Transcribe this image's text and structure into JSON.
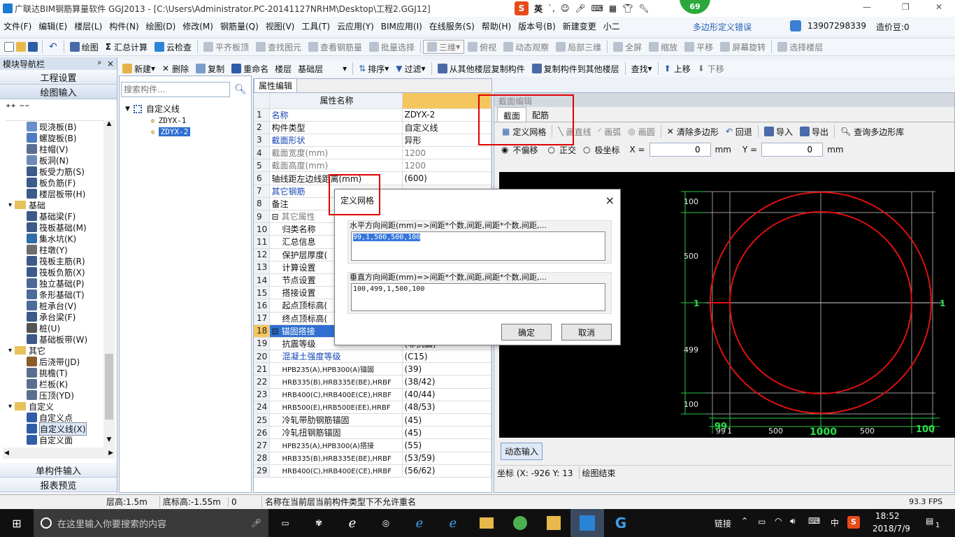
{
  "titlebar": {
    "app_title": "广联达BIM钢筋算量软件 GGJ2013 - [C:\\Users\\Administrator.PC-20141127NRHM\\Desktop\\工程2.GGJ12]",
    "ime_label": "英",
    "badge": "69",
    "window_controls": [
      "—",
      "❐",
      "✕"
    ]
  },
  "menubar": {
    "items": [
      "文件(F)",
      "编辑(E)",
      "楼层(L)",
      "构件(N)",
      "绘图(D)",
      "修改(M)",
      "钢筋量(Q)",
      "视图(V)",
      "工具(T)",
      "云应用(Y)",
      "BIM应用(I)",
      "在线服务(S)",
      "帮助(H)",
      "版本号(B)",
      "新建变更",
      "小二"
    ],
    "polygon_error": "多边形定义错误",
    "phone": "13907298339",
    "cost_bean": "造价豆:0"
  },
  "toolbar1": {
    "items": [
      "绘图",
      "汇总计算",
      "云检查",
      "平齐板顶",
      "查找图元",
      "查看钢筋量",
      "批量选择",
      "三维",
      "俯视",
      "动态观察",
      "局部三维",
      "全屏",
      "缩放",
      "平移",
      "屏幕旋转",
      "选择楼层"
    ]
  },
  "nav": {
    "title": "模块导航栏",
    "pin": "ᵖ",
    "close": "×",
    "buttons": [
      "工程设置",
      "绘图输入"
    ],
    "bottom_buttons": [
      "单构件输入",
      "报表预览"
    ],
    "tree": [
      {
        "label": "现浇板(B)",
        "level": 2,
        "icon_color": "#6b8fc9"
      },
      {
        "label": "螺旋板(B)",
        "level": 2,
        "icon_color": "#4e7cc2"
      },
      {
        "label": "柱帽(V)",
        "level": 2,
        "icon_color": "#5b6f93"
      },
      {
        "label": "板洞(N)",
        "level": 2,
        "icon_color": "#6e8bb5"
      },
      {
        "label": "板受力筋(S)",
        "level": 2,
        "icon_color": "#3c5a8a"
      },
      {
        "label": "板负筋(F)",
        "level": 2,
        "icon_color": "#3c5a8a"
      },
      {
        "label": "楼层板带(H)",
        "level": 2,
        "icon_color": "#3c5a8a"
      },
      {
        "label": "基础",
        "level": 1,
        "folder": true
      },
      {
        "label": "基础梁(F)",
        "level": 2,
        "icon_color": "#3c5a8a"
      },
      {
        "label": "筏板基础(M)",
        "level": 2,
        "icon_color": "#3c5a8a"
      },
      {
        "label": "集水坑(K)",
        "level": 2,
        "icon_color": "#2f6ea8"
      },
      {
        "label": "柱墩(Y)",
        "level": 2,
        "icon_color": "#6d6d6d"
      },
      {
        "label": "筏板主筋(R)",
        "level": 2,
        "icon_color": "#3c5a8a"
      },
      {
        "label": "筏板负筋(X)",
        "level": 2,
        "icon_color": "#3c5a8a"
      },
      {
        "label": "独立基础(P)",
        "level": 2,
        "icon_color": "#4d6a99"
      },
      {
        "label": "条形基础(T)",
        "level": 2,
        "icon_color": "#4d6a99"
      },
      {
        "label": "桩承台(V)",
        "level": 2,
        "icon_color": "#4d6a99"
      },
      {
        "label": "承台梁(F)",
        "level": 2,
        "icon_color": "#3c5a8a"
      },
      {
        "label": "桩(U)",
        "level": 2,
        "icon_color": "#555"
      },
      {
        "label": "基础板带(W)",
        "level": 2,
        "icon_color": "#3c5a8a"
      },
      {
        "label": "其它",
        "level": 1,
        "folder": true
      },
      {
        "label": "后浇带(JD)",
        "level": 2,
        "icon_color": "#8b5a2b"
      },
      {
        "label": "挑檐(T)",
        "level": 2,
        "icon_color": "#5a6f8f"
      },
      {
        "label": "栏板(K)",
        "level": 2,
        "icon_color": "#5a6f8f"
      },
      {
        "label": "压顶(YD)",
        "level": 2,
        "icon_color": "#5a6f8f"
      },
      {
        "label": "自定义",
        "level": 1,
        "folder": true
      },
      {
        "label": "自定义点",
        "level": 2,
        "icon_color": "#2f5ea8"
      },
      {
        "label": "自定义线(X)",
        "level": 2,
        "icon_color": "#2f5ea8",
        "selected": true
      },
      {
        "label": "自定义面",
        "level": 2,
        "icon_color": "#2f5ea8"
      }
    ]
  },
  "toolbar2": {
    "items": [
      "新建",
      "删除",
      "复制",
      "重命名",
      "楼层",
      "基础层",
      "排序",
      "过滤",
      "从其他楼层复制构件",
      "复制构件到其他楼层",
      "查找",
      "上移",
      "下移"
    ]
  },
  "comp_tree": {
    "search_placeholder": "搜索构件...",
    "root": "自定义线",
    "children": [
      "ZDYX-1",
      "ZDYX-2"
    ],
    "selected": "ZDYX-2"
  },
  "prop": {
    "tab": "属性编辑",
    "header_name": "属性名称",
    "header_value": "",
    "rows": [
      {
        "n": "1",
        "name": "名称",
        "value": "ZDYX-2",
        "name_style": "blue"
      },
      {
        "n": "2",
        "name": "构件类型",
        "value": "自定义线"
      },
      {
        "n": "3",
        "name": "截面形状",
        "value": "异形",
        "name_style": "blue"
      },
      {
        "n": "4",
        "name": "截面宽度(mm)",
        "value": "1200",
        "name_style": "gray",
        "value_style": "gray"
      },
      {
        "n": "5",
        "name": "截面高度(mm)",
        "value": "1200",
        "name_style": "gray",
        "value_style": "gray"
      },
      {
        "n": "6",
        "name": "轴线距左边线距离(mm)",
        "value": "(600)"
      },
      {
        "n": "7",
        "name": "其它钢筋",
        "value": "",
        "name_style": "blue"
      },
      {
        "n": "8",
        "name": "备注",
        "value": ""
      },
      {
        "n": "9",
        "name": "其它属性",
        "value": "",
        "group": true,
        "name_style": "gray"
      },
      {
        "n": "10",
        "name": "归类名称",
        "value": "",
        "indent": true
      },
      {
        "n": "11",
        "name": "汇总信息",
        "value": "",
        "indent": true
      },
      {
        "n": "12",
        "name": "保护层厚度(",
        "value": "",
        "indent": true
      },
      {
        "n": "13",
        "name": "计算设置",
        "value": "",
        "indent": true
      },
      {
        "n": "14",
        "name": "节点设置",
        "value": "",
        "indent": true
      },
      {
        "n": "15",
        "name": "搭接设置",
        "value": "",
        "indent": true
      },
      {
        "n": "16",
        "name": "起点顶标高(",
        "value": "",
        "indent": true
      },
      {
        "n": "17",
        "name": "终点顶标高(",
        "value": "",
        "indent": true
      },
      {
        "n": "18",
        "name": "锚固搭接",
        "value": "",
        "group": true,
        "highlight": true
      },
      {
        "n": "19",
        "name": "抗震等级",
        "value": "(非抗震)",
        "indent": true
      },
      {
        "n": "20",
        "name": "混凝土强度等级",
        "value": "(C15)",
        "indent": true,
        "name_style": "blue"
      },
      {
        "n": "21",
        "name": "HPB235(A),HPB300(A)锚固",
        "value": "(39)",
        "indent": true
      },
      {
        "n": "22",
        "name": "HRB335(B),HRB335E(BE),HRBF",
        "value": "(38/42)",
        "indent": true
      },
      {
        "n": "23",
        "name": "HRB400(C),HRB400E(CE),HRBF",
        "value": "(40/44)",
        "indent": true
      },
      {
        "n": "24",
        "name": "HRB500(E),HRB500E(EE),HRBF",
        "value": "(48/53)",
        "indent": true
      },
      {
        "n": "25",
        "name": "冷轧带肋钢筋锚固",
        "value": "(45)",
        "indent": true
      },
      {
        "n": "26",
        "name": "冷轧扭钢筋锚固",
        "value": "(45)",
        "indent": true
      },
      {
        "n": "27",
        "name": "HPB235(A),HPB300(A)搭接",
        "value": "(55)",
        "indent": true
      },
      {
        "n": "28",
        "name": "HRB335(B),HRB335E(BE),HRBF",
        "value": "(53/59)",
        "indent": true
      },
      {
        "n": "29",
        "name": "HRB400(C),HRB400E(CE),HRBF",
        "value": "(56/62)",
        "indent": true
      }
    ]
  },
  "section": {
    "title": "截面编辑",
    "tabs": [
      "截面",
      "配筋"
    ],
    "tools": [
      "定义网格",
      "画直线",
      "画弧",
      "画圆",
      "清除多边形",
      "回退",
      "导入",
      "导出",
      "查询多边形库"
    ],
    "radios": [
      "不偏移",
      "正交",
      "极坐标"
    ],
    "x_label": "X =",
    "x_value": "0",
    "y_label": "Y =",
    "y_value": "0",
    "unit": "mm",
    "dynamic_input": "动态输入",
    "coord": "坐标 (X: -926 Y: 13",
    "draw_end": "绘图结束",
    "grid_left_labels": [
      "100",
      "500",
      "499",
      "100"
    ],
    "grid_bottom_labels": [
      "99",
      "1",
      "500",
      "1000",
      "500",
      "100"
    ],
    "axis_label_left": "1",
    "axis_label_right": "1"
  },
  "dialog": {
    "title": "定义网格",
    "close": "×",
    "h_label": "水平方向间距(mm)=>间距*个数,间距,间距*个数,间距,...",
    "h_value": "99,1,500,500,100",
    "v_label": "垂直方向间距(mm)=>间距*个数,间距,间距*个数,间距,...",
    "v_value": "100,499,1,500,100",
    "ok": "确定",
    "cancel": "取消"
  },
  "status": {
    "floor_height": "层高:1.5m",
    "base_elev": "底标高:-1.55m",
    "zero": "0",
    "message": "名称在当前层当前构件类型下不允许重名",
    "fps": "93.3 FPS"
  },
  "taskbar": {
    "search_placeholder": "在这里输入你要搜索的内容",
    "link": "链接",
    "lang": "中",
    "time": "18:52",
    "date": "2018/7/9",
    "notif": "1"
  }
}
